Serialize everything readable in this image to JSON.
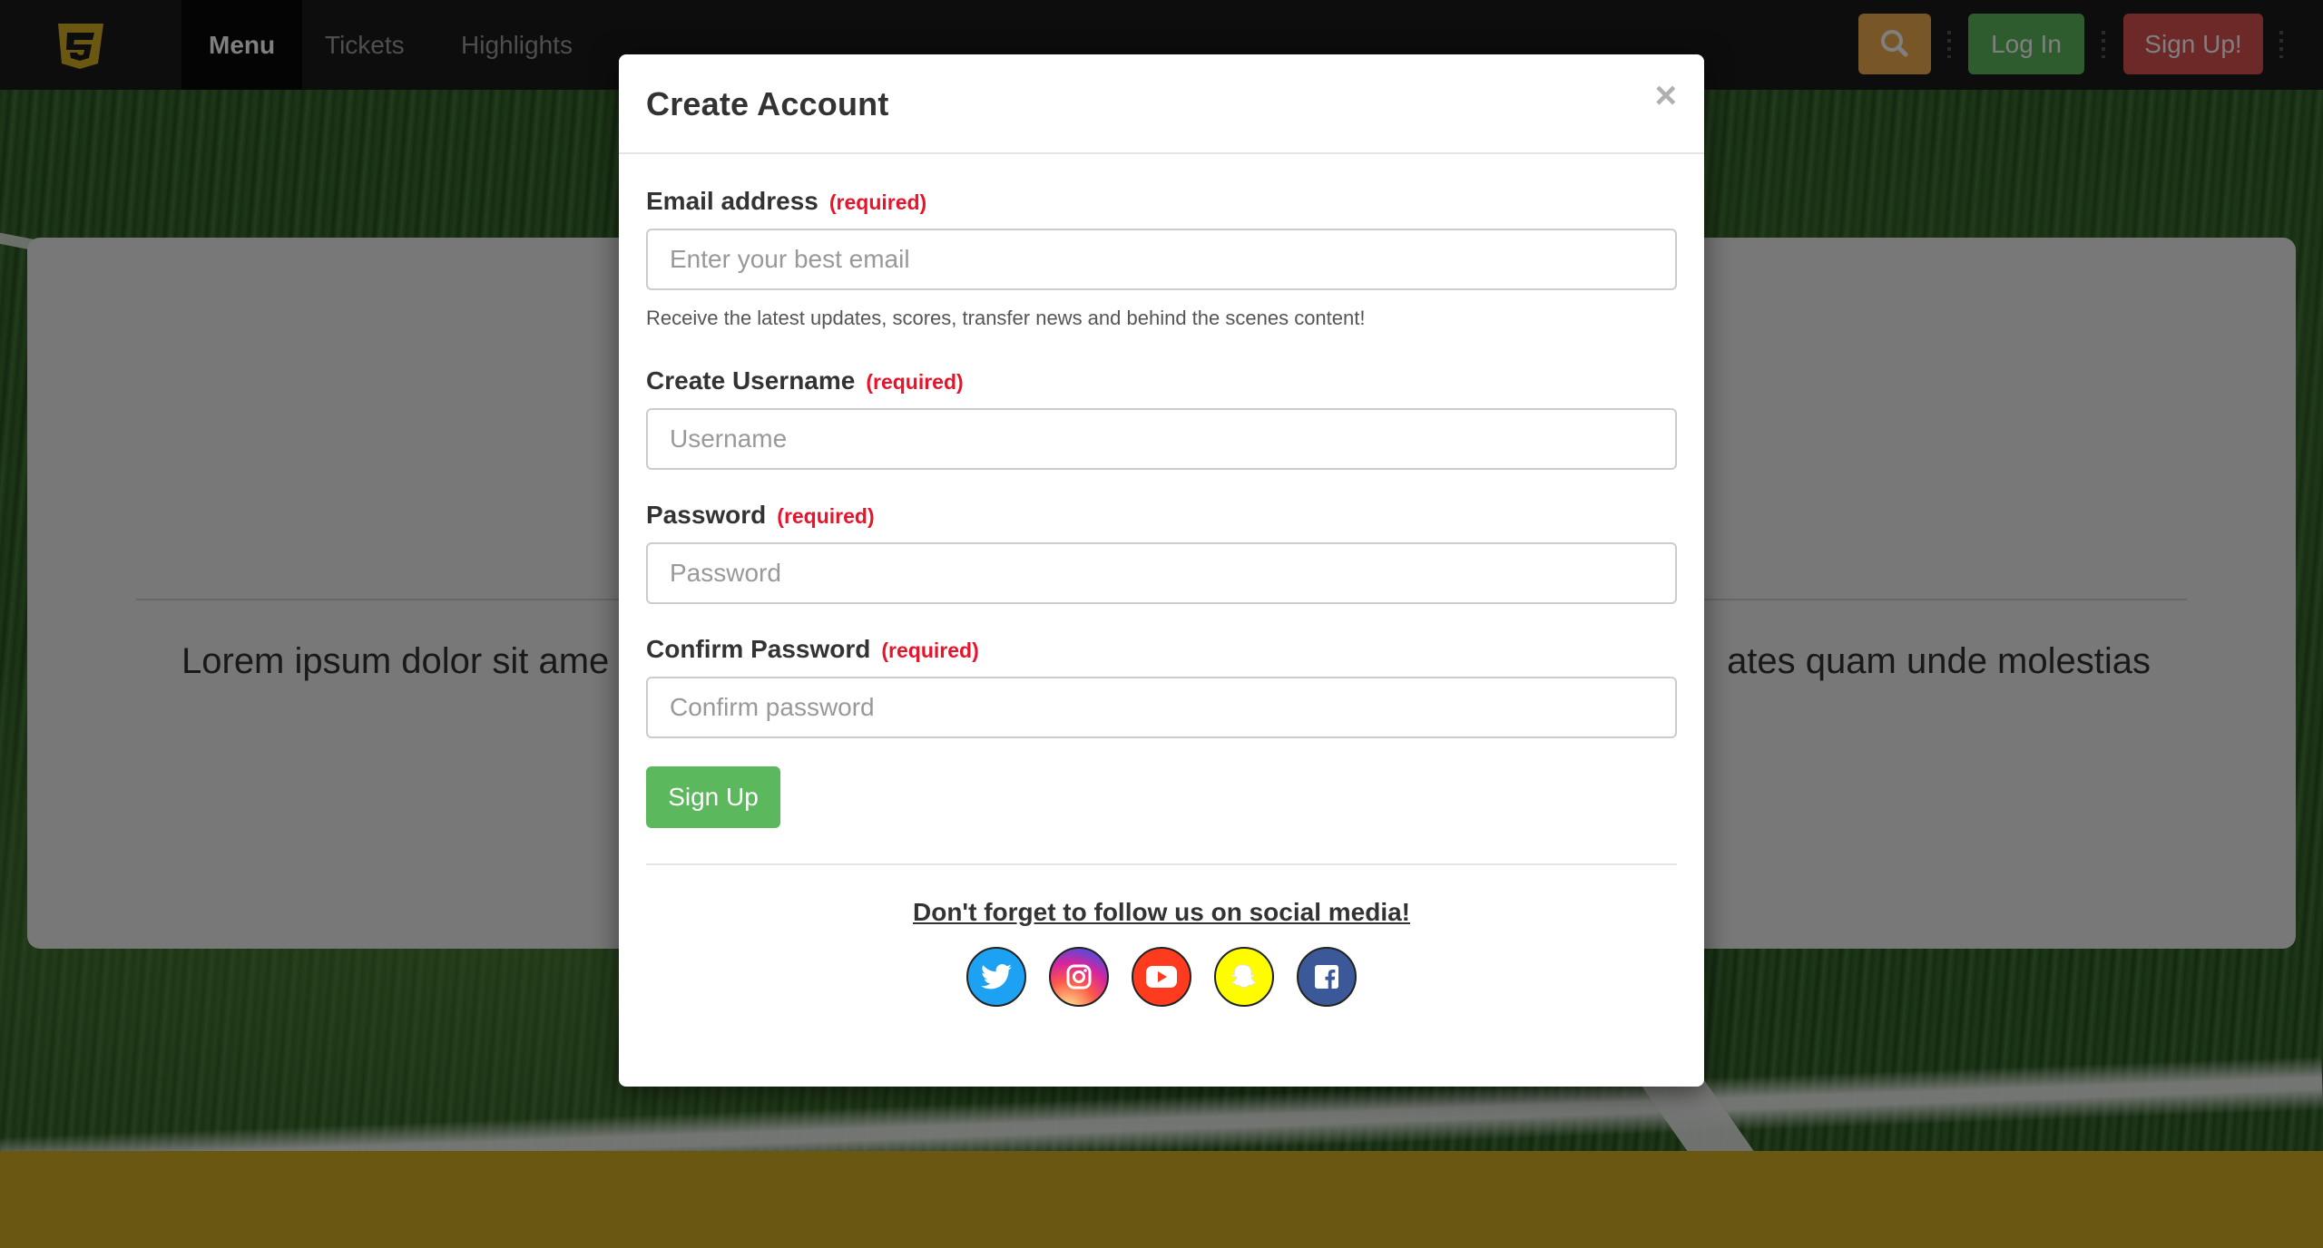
{
  "navbar": {
    "logo_icon": "css3-icon",
    "items": [
      {
        "label": "Menu",
        "active": true
      },
      {
        "label": "Tickets",
        "active": false
      },
      {
        "label": "Highlights",
        "active": false
      }
    ],
    "search_icon": "search-icon",
    "login_label": "Log In",
    "signup_label": "Sign Up!"
  },
  "hero": {
    "text_left": "Lorem ipsum dolor sit ame",
    "text_right": "ates quam unde molestias"
  },
  "modal": {
    "title": "Create Account",
    "close_label": "×",
    "required_label": "(required)",
    "email": {
      "label": "Email address",
      "placeholder": "Enter your best email",
      "help": "Receive the latest updates, scores, transfer news and behind the scenes content!"
    },
    "username": {
      "label": "Create Username",
      "placeholder": "Username"
    },
    "password": {
      "label": "Password",
      "placeholder": "Password"
    },
    "confirm": {
      "label": "Confirm Password",
      "placeholder": "Confirm password"
    },
    "submit_label": "Sign Up",
    "social_text": "Don't forget to follow us on social media!",
    "social": [
      "twitter-icon",
      "instagram-icon",
      "youtube-icon",
      "snapchat-icon",
      "facebook-icon"
    ]
  },
  "colors": {
    "success": "#5cb85c",
    "danger": "#d9534f",
    "warning": "#f0ad4e",
    "required": "#e8142b",
    "footer": "#d4b125"
  }
}
